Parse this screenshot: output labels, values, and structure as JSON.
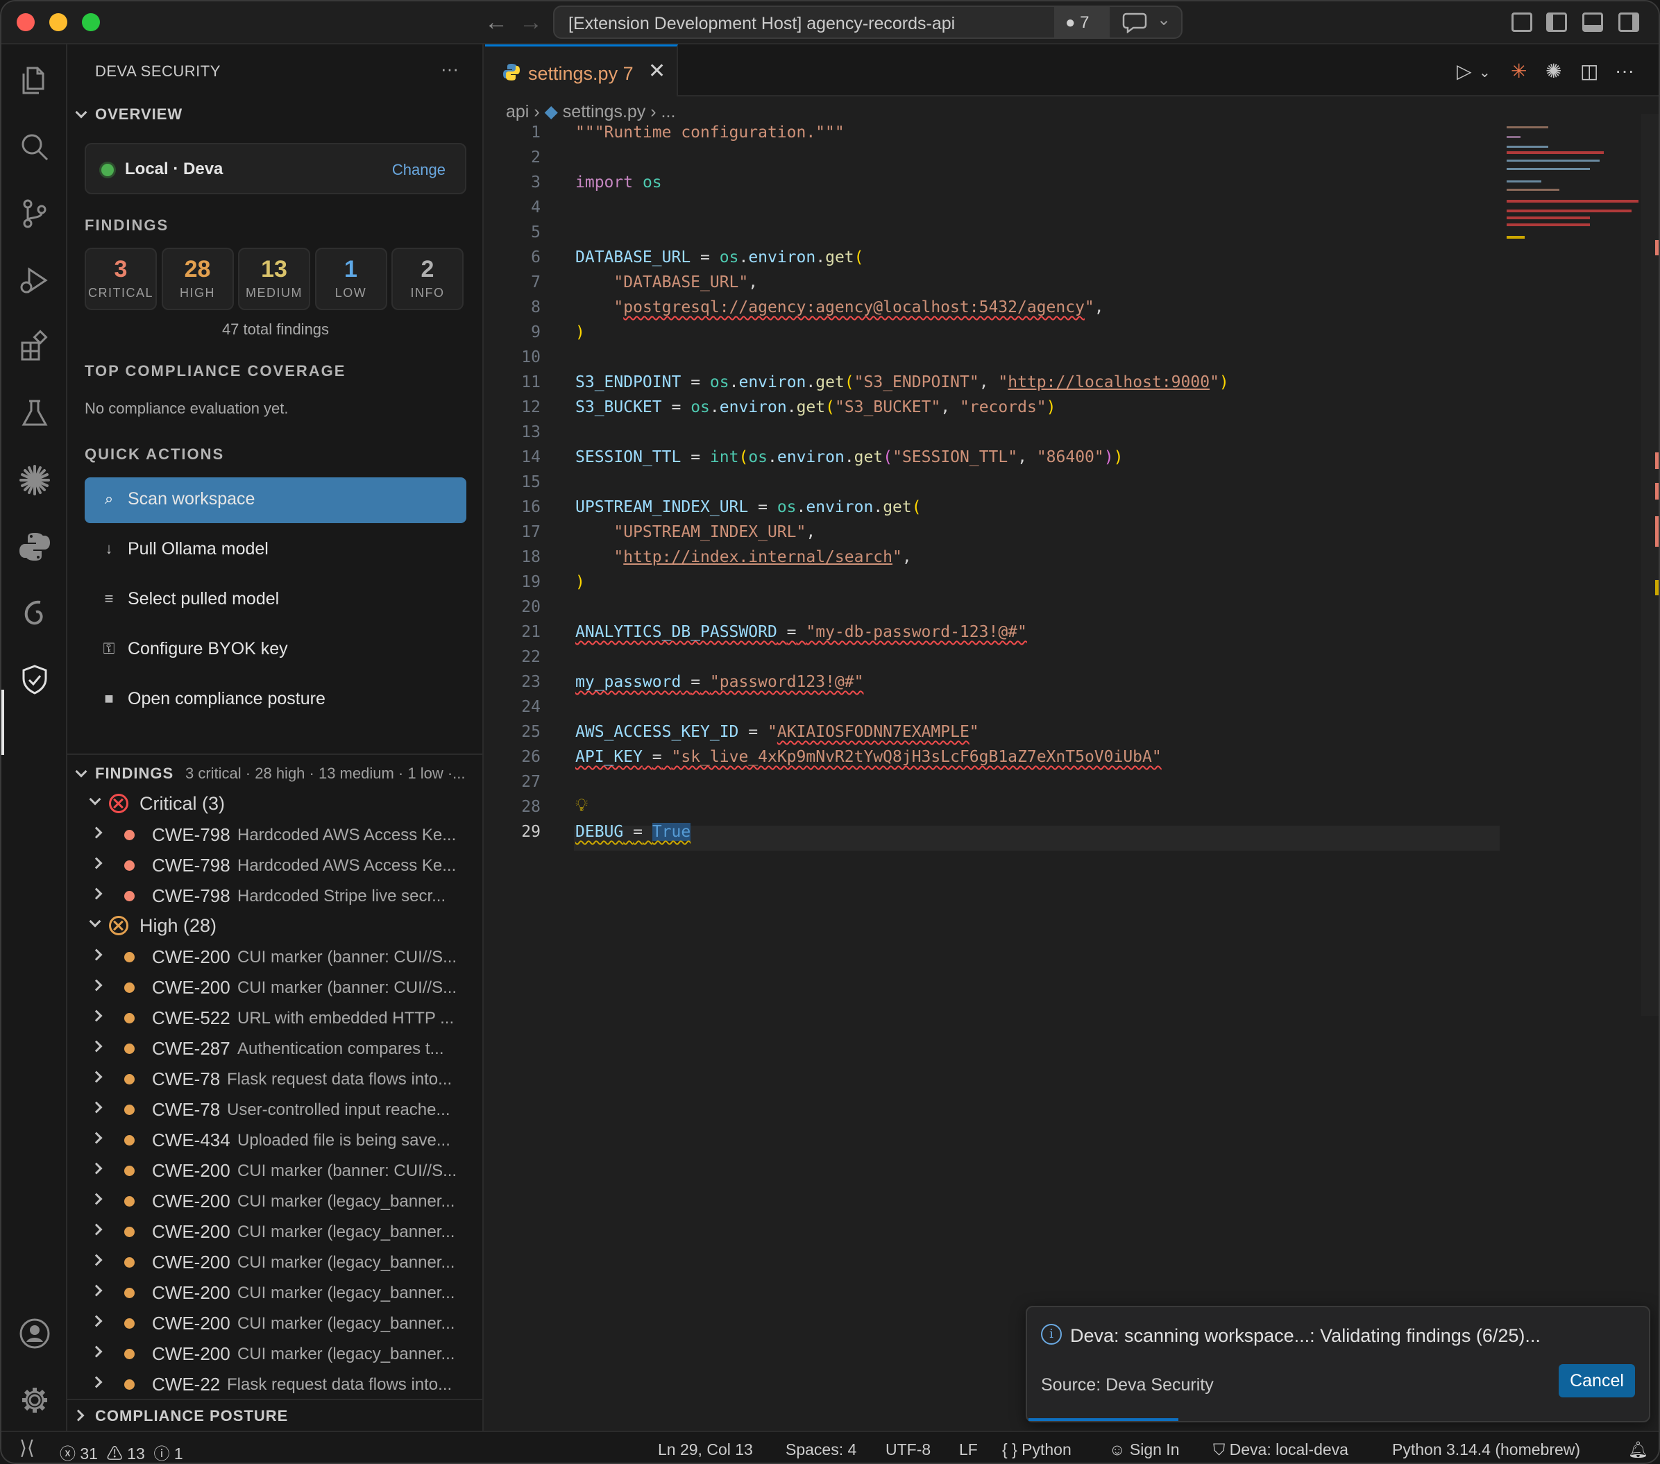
{
  "window": {
    "title": "[Extension Development Host] agency-records-api",
    "problems_badge": "7"
  },
  "sidebar": {
    "title": "DEVA SECURITY",
    "overview_header": "OVERVIEW",
    "environment": {
      "label": "Local · Deva",
      "change": "Change"
    },
    "findings_label": "FINDINGS",
    "counts": [
      {
        "value": "3",
        "label": "CRITICAL",
        "color": "#e8826a"
      },
      {
        "value": "28",
        "label": "HIGH",
        "color": "#e3a04f"
      },
      {
        "value": "13",
        "label": "MEDIUM",
        "color": "#d9c26a"
      },
      {
        "value": "1",
        "label": "LOW",
        "color": "#5ea8e6"
      },
      {
        "value": "2",
        "label": "INFO",
        "color": "#b0b0b0"
      }
    ],
    "total": "47 total findings",
    "compliance_label": "TOP COMPLIANCE COVERAGE",
    "compliance_empty": "No compliance evaluation yet.",
    "quick_actions_label": "QUICK ACTIONS",
    "quick_actions": [
      {
        "icon": "search-icon",
        "label": "Scan workspace"
      },
      {
        "icon": "download-icon",
        "label": "Pull Ollama model"
      },
      {
        "icon": "list-icon",
        "label": "Select pulled model"
      },
      {
        "icon": "key-icon",
        "label": "Configure BYOK key"
      },
      {
        "icon": "square-icon",
        "label": "Open compliance posture"
      }
    ],
    "findings_tree": {
      "header": "FINDINGS",
      "summary": "3 critical · 28 high · 13 medium · 1 low ·...",
      "groups": [
        {
          "label": "Critical (3)",
          "color": "#f14c4c",
          "dot": "#f48771",
          "items": [
            {
              "cwe": "CWE-798",
              "desc": "Hardcoded AWS Access Ke..."
            },
            {
              "cwe": "CWE-798",
              "desc": "Hardcoded AWS Access Ke..."
            },
            {
              "cwe": "CWE-798",
              "desc": "Hardcoded Stripe live secr..."
            }
          ]
        },
        {
          "label": "High (28)",
          "color": "#e3a04f",
          "dot": "#e3a04f",
          "items": [
            {
              "cwe": "CWE-200",
              "desc": "CUI marker (banner: CUI//S..."
            },
            {
              "cwe": "CWE-200",
              "desc": "CUI marker (banner: CUI//S..."
            },
            {
              "cwe": "CWE-522",
              "desc": "URL with embedded HTTP ..."
            },
            {
              "cwe": "CWE-287",
              "desc": "Authentication compares t..."
            },
            {
              "cwe": "CWE-78",
              "desc": "Flask request data flows into..."
            },
            {
              "cwe": "CWE-78",
              "desc": "User-controlled input reache..."
            },
            {
              "cwe": "CWE-434",
              "desc": "Uploaded file is being save..."
            },
            {
              "cwe": "CWE-200",
              "desc": "CUI marker (banner: CUI//S..."
            },
            {
              "cwe": "CWE-200",
              "desc": "CUI marker (legacy_banner..."
            },
            {
              "cwe": "CWE-200",
              "desc": "CUI marker (legacy_banner..."
            },
            {
              "cwe": "CWE-200",
              "desc": "CUI marker (legacy_banner..."
            },
            {
              "cwe": "CWE-200",
              "desc": "CUI marker (legacy_banner..."
            },
            {
              "cwe": "CWE-200",
              "desc": "CUI marker (legacy_banner..."
            },
            {
              "cwe": "CWE-200",
              "desc": "CUI marker (legacy_banner..."
            },
            {
              "cwe": "CWE-22",
              "desc": "Flask request data flows into..."
            }
          ]
        }
      ]
    },
    "compliance_posture_header": "COMPLIANCE POSTURE"
  },
  "editor": {
    "tab": {
      "name": "settings.py",
      "problems": "7"
    },
    "breadcrumb": {
      "folder": "api",
      "file": "settings.py",
      "rest": "..."
    },
    "active_line": 29
  },
  "notification": {
    "message": "Deva: scanning workspace...: Validating findings (6/25)...",
    "source": "Source: Deva Security",
    "cancel": "Cancel",
    "progress": 0.24
  },
  "statusbar": {
    "errors": "31",
    "warnings": "13",
    "infos": "1",
    "position": "Ln 29, Col 13",
    "spaces": "Spaces: 4",
    "encoding": "UTF-8",
    "eol": "LF",
    "language": "Python",
    "signin": "Sign In",
    "deva": "Deva: local-deva",
    "interpreter": "Python 3.14.4 (homebrew)"
  }
}
